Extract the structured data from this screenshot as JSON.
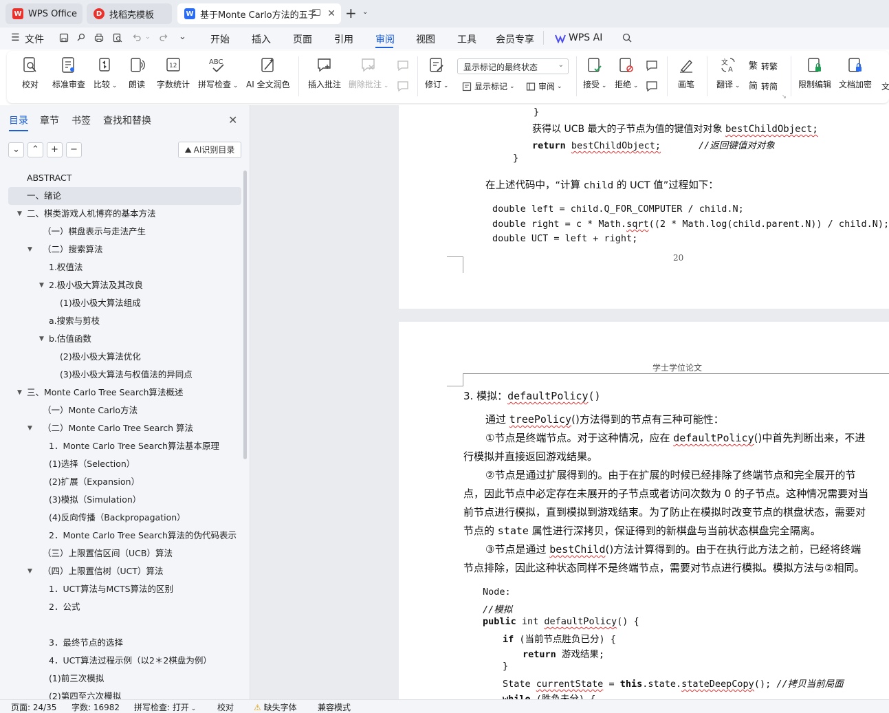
{
  "tabs": [
    {
      "label": "WPS Office",
      "icon": "wps-logo-icon"
    },
    {
      "label": "找稻壳模板",
      "icon": "docer-icon"
    },
    {
      "label": "基于Monte Carlo方法的五子",
      "icon": "writer-doc-icon"
    }
  ],
  "menu": {
    "file": "文件",
    "items": [
      "开始",
      "插入",
      "页面",
      "引用",
      "审阅",
      "视图",
      "工具",
      "会员专享"
    ],
    "active": "审阅",
    "ai": "WPS AI"
  },
  "ribbon": {
    "proofread": "校对",
    "standard_review": "标准审查",
    "compare": "比较",
    "read_aloud": "朗读",
    "word_count": "字数统计",
    "spell_check": "拼写检查",
    "ai_polish": "AI 全文润色",
    "insert_comment": "插入批注",
    "delete_comment": "删除批注",
    "revise": "修订",
    "markup_select": "显示标记的最终状态",
    "show_markup": "显示标记",
    "review": "审阅",
    "accept": "接受",
    "reject": "拒绝",
    "pen": "画笔",
    "translate": "翻译",
    "to_traditional": "转繁",
    "to_simplified": "转简",
    "restrict_edit": "限制编辑",
    "encrypt": "文档加密",
    "more": "文"
  },
  "sidebar": {
    "tabs": [
      "目录",
      "章节",
      "书签",
      "查找和替换"
    ],
    "active_tab": "目录",
    "ai_toc": "AI识别目录",
    "toc": [
      {
        "label": "ABSTRACT",
        "level": 0,
        "arrow": ""
      },
      {
        "label": "一、绪论",
        "level": 0,
        "arrow": "",
        "active": true
      },
      {
        "label": "二、棋类游戏人机博弈的基本方法",
        "level": 0,
        "arrow": "▼"
      },
      {
        "label": "（一）棋盘表示与走法产生",
        "level": 1,
        "arrow": ""
      },
      {
        "label": "（二）搜索算法",
        "level": 1,
        "arrow": "▼"
      },
      {
        "label": "1.权值法",
        "level": 2,
        "arrow": ""
      },
      {
        "label": "2.极小极大算法及其改良",
        "level": 2,
        "arrow": "▼"
      },
      {
        "label": "(1)极小极大算法组成",
        "level": 3,
        "arrow": ""
      },
      {
        "label": "a.搜索与剪枝",
        "level": 2,
        "arrow": ""
      },
      {
        "label": "b.估值函数",
        "level": 2,
        "arrow": "▼"
      },
      {
        "label": "(2)极小极大算法优化",
        "level": 3,
        "arrow": ""
      },
      {
        "label": "(3)极小极大算法与权值法的异同点",
        "level": 3,
        "arrow": ""
      },
      {
        "label": "三、Monte Carlo Tree Search算法概述",
        "level": 0,
        "arrow": "▼"
      },
      {
        "label": "（一）Monte Carlo方法",
        "level": 1,
        "arrow": ""
      },
      {
        "label": "（二）Monte Carlo Tree Search 算法",
        "level": 1,
        "arrow": "▼"
      },
      {
        "label": "1．Monte Carlo Tree Search算法基本原理",
        "level": 2,
        "arrow": ""
      },
      {
        "label": "(1)选择（Selection）",
        "level": 2,
        "arrow": ""
      },
      {
        "label": "(2)扩展（Expansion）",
        "level": 2,
        "arrow": ""
      },
      {
        "label": "(3)模拟（Simulation）",
        "level": 2,
        "arrow": ""
      },
      {
        "label": "(4)反向传播（Backpropagation）",
        "level": 2,
        "arrow": ""
      },
      {
        "label": "2．Monte Carlo Tree Search算法的伪代码表示",
        "level": 2,
        "arrow": ""
      },
      {
        "label": "（三）上限置信区间（UCB）算法",
        "level": 1,
        "arrow": ""
      },
      {
        "label": "（四）上限置信树（UCT）算法",
        "level": 1,
        "arrow": "▼"
      },
      {
        "label": "1．UCT算法与MCTS算法的区别",
        "level": 2,
        "arrow": ""
      },
      {
        "label": "2．公式",
        "level": 2,
        "arrow": ""
      },
      {
        "label": "",
        "level": 2,
        "arrow": ""
      },
      {
        "label": "3．最终节点的选择",
        "level": 2,
        "arrow": ""
      },
      {
        "label": "4．UCT算法过程示例（以2＊2棋盘为例）",
        "level": 2,
        "arrow": ""
      },
      {
        "label": "(1)前三次模拟",
        "level": 2,
        "arrow": ""
      },
      {
        "label": "(2)第四至六次模拟",
        "level": 2,
        "arrow": ""
      }
    ]
  },
  "page1": {
    "brace1": "}",
    "line_get": "获得以 UCB 最大的子节点为值的键值对对象 ",
    "line_get_code": "bestChildObject;",
    "ret_kw": "return",
    "ret_val": "bestChildObject;",
    "ret_comment": "//返回键值对对象",
    "brace2": "}",
    "para_a": "在上述代码中，“计算 ",
    "para_code": "child",
    "para_b": " 的 UCT 值”过程如下：",
    "code1": "double left = child.Q_FOR_COMPUTER / child.N;",
    "code2a": "double right = c * Math.",
    "code2b": "sqrt",
    "code2c": "((2 * Math.log(child.parent.N)) / child.N);",
    "code3": "double UCT = left + right;",
    "page_number": "20"
  },
  "page2": {
    "header": "学士学位论文",
    "heading_a": "3. 模拟：",
    "heading_code": "defaultPolicy",
    "heading_b": "()",
    "p1_a": "通过 ",
    "p1_code": "treePolicy",
    "p1_b": "()方法得到的节点有三种可能性：",
    "p2_a": "①节点是终端节点。对于这种情况，应在 ",
    "p2_code": "defaultPolicy",
    "p2_b": "()中首先判断出来，不进",
    "p2_c": "行模拟并直接返回游戏结果。",
    "p3_l1": "②节点是通过扩展得到的。由于在扩展的时候已经排除了终端节点和完全展开的节",
    "p3_l2": "点，因此节点中必定存在未展开的子节点或者访问次数为 0 的子节点。这种情况需要对当",
    "p3_l3": "前节点进行模拟，直到模拟到游戏结束。为了防止在模拟时改变节点的棋盘状态，需要对",
    "p3_l4a": "节点的 ",
    "p3_l4code": "state",
    "p3_l4b": " 属性进行深拷贝，保证得到的新棋盘与当前状态棋盘完全隔离。",
    "p4_l1a": "③节点是通过 ",
    "p4_l1code": "bestChild",
    "p4_l1b": "()方法计算得到的。由于在执行此方法之前，已经将终端",
    "p4_l2": "节点排除，因此这种状态同样不是终端节点，需要对节点进行模拟。模拟方法与②相同。",
    "c1": "Node:",
    "c2": "//模拟",
    "c3_kw": "public",
    "c3_a": " int ",
    "c3_fn": "defaultPolicy",
    "c3_b": "() {",
    "c4_kw": "if",
    "c4_b": " (当前节点胜负已分) {",
    "c5_kw": "return",
    "c5_b": " 游戏结果;",
    "c6": "}",
    "c7_a": "State ",
    "c7_var": "currentState",
    "c7_b": " = ",
    "c7_kw": "this",
    "c7_c": ".state.",
    "c7_fn": "stateDeepCopy",
    "c7_d": "(); ",
    "c7_cm": "//拷贝当前局面",
    "c8_kw": "while",
    "c8_b": " (胜负未分) {"
  },
  "status": {
    "page": "页面: 24/35",
    "words": "字数: 16982",
    "spell": "拼写检查: 打开",
    "proof": "校对",
    "missing_font": "缺失字体",
    "compat": "兼容模式"
  },
  "colors": {
    "accent": "#1a5fd8",
    "wps_red": "#e8322b",
    "writer_blue": "#2a6df4"
  }
}
